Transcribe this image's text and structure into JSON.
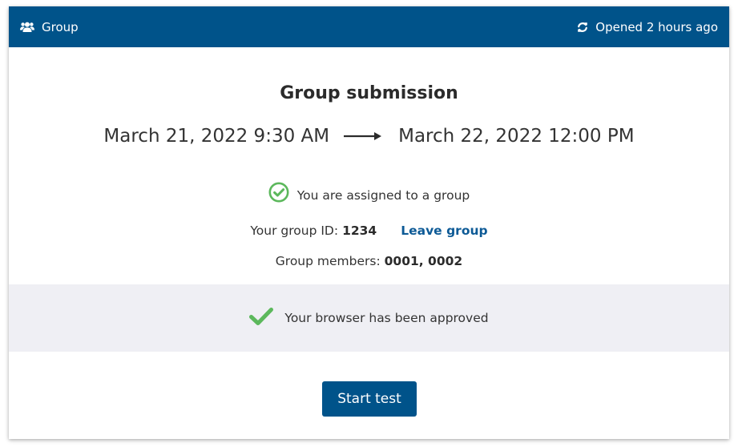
{
  "header": {
    "group_label": "Group",
    "status_text": "Opened 2 hours ago",
    "background_color": "#00538a"
  },
  "submission": {
    "title": "Group submission",
    "start_datetime": "March 21, 2022 9:30 AM",
    "end_datetime": "March 22, 2022 12:00 PM"
  },
  "group": {
    "assigned_text": "You are assigned to a group",
    "id_label": "Your group ID:",
    "id_value": "1234",
    "leave_link_label": "Leave group",
    "members_label": "Group members:",
    "members_value": "0001, 0002"
  },
  "browser": {
    "approved_text": "Your browser has been approved",
    "success_color": "#5cb85c"
  },
  "actions": {
    "start_label": "Start test"
  }
}
